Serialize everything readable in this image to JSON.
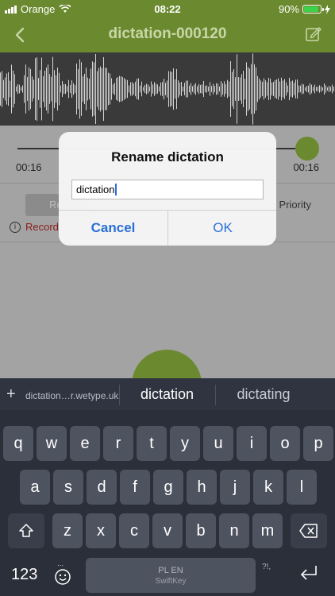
{
  "status": {
    "carrier": "Orange",
    "time": "08:22",
    "battery": "90%",
    "battery_level": 0.9
  },
  "nav": {
    "title": "dictation-000120",
    "back_icon": "chevron-left-icon",
    "edit_icon": "edit-icon"
  },
  "player": {
    "elapsed": "00:16",
    "total": "00:16"
  },
  "options": {
    "record_button": "Re",
    "priority_label": "Priority",
    "info_text": "Record"
  },
  "dialog": {
    "title": "Rename dictation",
    "input_value": "dictation",
    "cancel_label": "Cancel",
    "ok_label": "OK"
  },
  "keyboard": {
    "hint": "dictation…r.wetype.uk",
    "prediction_center": "dictation",
    "prediction_right": "dictating",
    "rows": [
      [
        "q",
        "w",
        "e",
        "r",
        "t",
        "y",
        "u",
        "i",
        "o",
        "p"
      ],
      [
        "a",
        "s",
        "d",
        "f",
        "g",
        "h",
        "j",
        "k",
        "l"
      ],
      [
        "z",
        "x",
        "c",
        "v",
        "b",
        "n",
        "m"
      ]
    ],
    "numbers_label": "123",
    "space_label": "PL EN",
    "space_brand": "SwiftKey",
    "punct_label": "?!,"
  },
  "colors": {
    "brand_green": "#6b8a2f",
    "link_blue": "#2a6fd6"
  }
}
